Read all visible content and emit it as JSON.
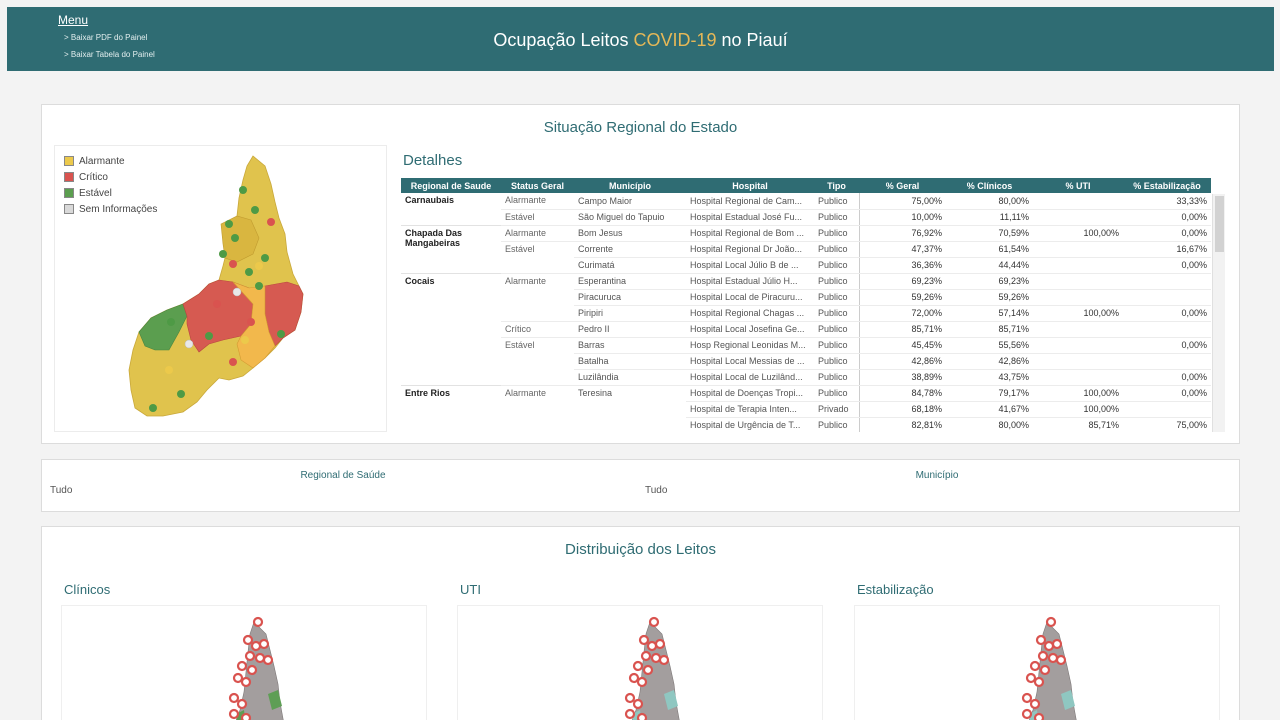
{
  "header": {
    "menu_title": "Menu",
    "links": [
      "> Baixar PDF do Painel",
      "> Baixar Tabela do Painel"
    ],
    "title_prefix": "Ocupação Leitos ",
    "title_accent": "COVID-19",
    "title_suffix": " no Piauí"
  },
  "regional": {
    "title": "Situação Regional do Estado",
    "legend": [
      {
        "label": "Alarmante",
        "color": "#ecc94b"
      },
      {
        "label": "Crítico",
        "color": "#d9534f"
      },
      {
        "label": "Estável",
        "color": "#5b9e4f"
      },
      {
        "label": "Sem Informações",
        "color": "#d9d9d9"
      }
    ],
    "details_title": "Detalhes",
    "columns": [
      "Regional de Saude",
      "Status Geral",
      "Município",
      "Hospital",
      "Tipo",
      "% Geral",
      "% Clínicos",
      "% UTI",
      "% Estabilização"
    ],
    "rows": [
      {
        "regional": "Carnaubais",
        "status": "Alarmante",
        "municipio": "Campo Maior",
        "hospital": "Hospital Regional de Cam...",
        "tipo": "Publico",
        "geral": "75,00%",
        "clinicos": "80,00%",
        "uti": "",
        "estab": "33,33%"
      },
      {
        "regional": "",
        "status": "Estável",
        "municipio": "São Miguel do Tapuio",
        "hospital": "Hospital Estadual José Fu...",
        "tipo": "Publico",
        "geral": "10,00%",
        "clinicos": "11,11%",
        "uti": "",
        "estab": "0,00%"
      },
      {
        "regional": "Chapada Das Mangabeiras",
        "status": "Alarmante",
        "municipio": "Bom Jesus",
        "hospital": "Hospital Regional de Bom ...",
        "tipo": "Publico",
        "geral": "76,92%",
        "clinicos": "70,59%",
        "uti": "100,00%",
        "estab": "0,00%"
      },
      {
        "regional": "",
        "status": "Estável",
        "municipio": "Corrente",
        "hospital": "Hospital Regional Dr João...",
        "tipo": "Publico",
        "geral": "47,37%",
        "clinicos": "61,54%",
        "uti": "",
        "estab": "16,67%"
      },
      {
        "regional": "",
        "status": "",
        "municipio": "Curimatá",
        "hospital": "Hospital Local Júlio B de ...",
        "tipo": "Publico",
        "geral": "36,36%",
        "clinicos": "44,44%",
        "uti": "",
        "estab": "0,00%"
      },
      {
        "regional": "Cocais",
        "status": "Alarmante",
        "municipio": "Esperantina",
        "hospital": "Hospital Estadual Júlio H...",
        "tipo": "Publico",
        "geral": "69,23%",
        "clinicos": "69,23%",
        "uti": "",
        "estab": ""
      },
      {
        "regional": "",
        "status": "",
        "municipio": "Piracuruca",
        "hospital": "Hospital Local de Piracuru...",
        "tipo": "Publico",
        "geral": "59,26%",
        "clinicos": "59,26%",
        "uti": "",
        "estab": ""
      },
      {
        "regional": "",
        "status": "",
        "municipio": "Piripiri",
        "hospital": "Hospital Regional Chagas ...",
        "tipo": "Publico",
        "geral": "72,00%",
        "clinicos": "57,14%",
        "uti": "100,00%",
        "estab": "0,00%"
      },
      {
        "regional": "",
        "status": "Crítico",
        "municipio": "Pedro II",
        "hospital": "Hospital Local Josefina Ge...",
        "tipo": "Publico",
        "geral": "85,71%",
        "clinicos": "85,71%",
        "uti": "",
        "estab": ""
      },
      {
        "regional": "",
        "status": "Estável",
        "municipio": "Barras",
        "hospital": "Hosp Regional Leonidas M...",
        "tipo": "Publico",
        "geral": "45,45%",
        "clinicos": "55,56%",
        "uti": "",
        "estab": "0,00%"
      },
      {
        "regional": "",
        "status": "",
        "municipio": "Batalha",
        "hospital": "Hospital Local Messias de ...",
        "tipo": "Publico",
        "geral": "42,86%",
        "clinicos": "42,86%",
        "uti": "",
        "estab": ""
      },
      {
        "regional": "",
        "status": "",
        "municipio": "Luzilândia",
        "hospital": "Hospital Local de Luzilând...",
        "tipo": "Publico",
        "geral": "38,89%",
        "clinicos": "43,75%",
        "uti": "",
        "estab": "0,00%"
      },
      {
        "regional": "Entre Rios",
        "status": "Alarmante",
        "municipio": "Teresina",
        "hospital": "Hospital de Doenças Tropi...",
        "tipo": "Publico",
        "geral": "84,78%",
        "clinicos": "79,17%",
        "uti": "100,00%",
        "estab": "0,00%"
      },
      {
        "regional": "",
        "status": "",
        "municipio": "",
        "hospital": "Hospital de Terapia Inten...",
        "tipo": "Privado",
        "geral": "68,18%",
        "clinicos": "41,67%",
        "uti": "100,00%",
        "estab": ""
      },
      {
        "regional": "",
        "status": "",
        "municipio": "",
        "hospital": "Hospital de Urgência de T...",
        "tipo": "Publico",
        "geral": "82,81%",
        "clinicos": "80,00%",
        "uti": "85,71%",
        "estab": "75,00%"
      }
    ]
  },
  "filters": {
    "regional_label": "Regional de Saúde",
    "regional_value": "Tudo",
    "municipio_label": "Município",
    "municipio_value": "Tudo"
  },
  "distribution": {
    "title": "Distribuição dos Leitos",
    "panels": [
      "Clínicos",
      "UTI",
      "Estabilização"
    ]
  }
}
